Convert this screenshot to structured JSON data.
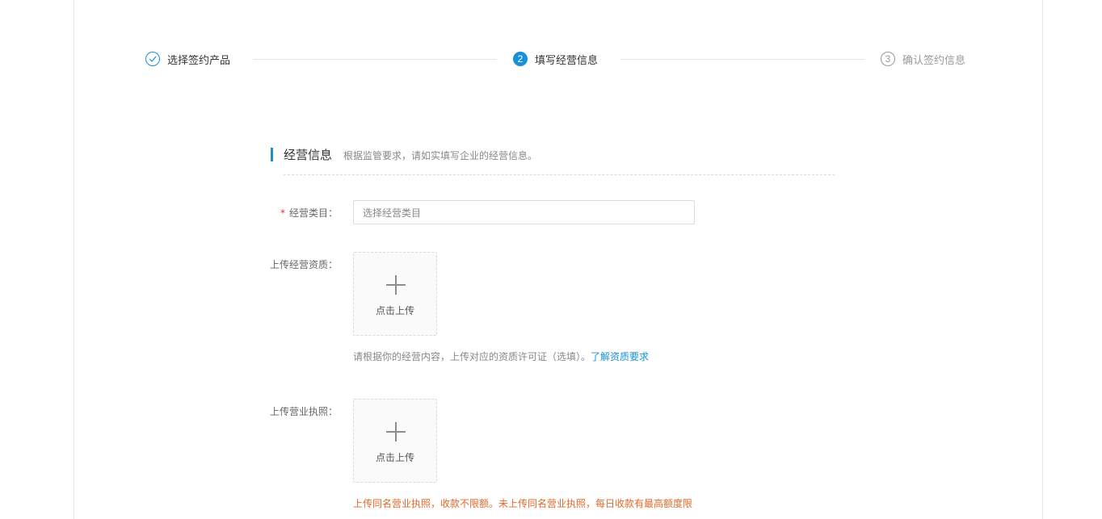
{
  "steps": [
    {
      "index": "✓",
      "label": "选择签约产品",
      "state": "done"
    },
    {
      "index": "2",
      "label": "填写经营信息",
      "state": "active"
    },
    {
      "index": "3",
      "label": "确认签约信息",
      "state": "wait"
    }
  ],
  "section": {
    "title": "经营信息",
    "description": "根据监管要求，请如实填写企业的经营信息。"
  },
  "form": {
    "category": {
      "required_mark": "*",
      "label": "经营类目：",
      "placeholder": "选择经营类目"
    },
    "qualification": {
      "label": "上传经营资质：",
      "upload_text": "点击上传",
      "hint": "请根据你的经营内容，上传对应的资质许可证（选填）。",
      "hint_link": "了解资质要求"
    },
    "license": {
      "label": "上传营业执照：",
      "upload_text": "点击上传",
      "warning": "上传同名营业执照，收款不限额。未上传同名营业执照，每日收款有最高额度限"
    }
  },
  "colors": {
    "accent": "#1890d9",
    "warning": "#e5682a",
    "required": "#d9363e"
  }
}
